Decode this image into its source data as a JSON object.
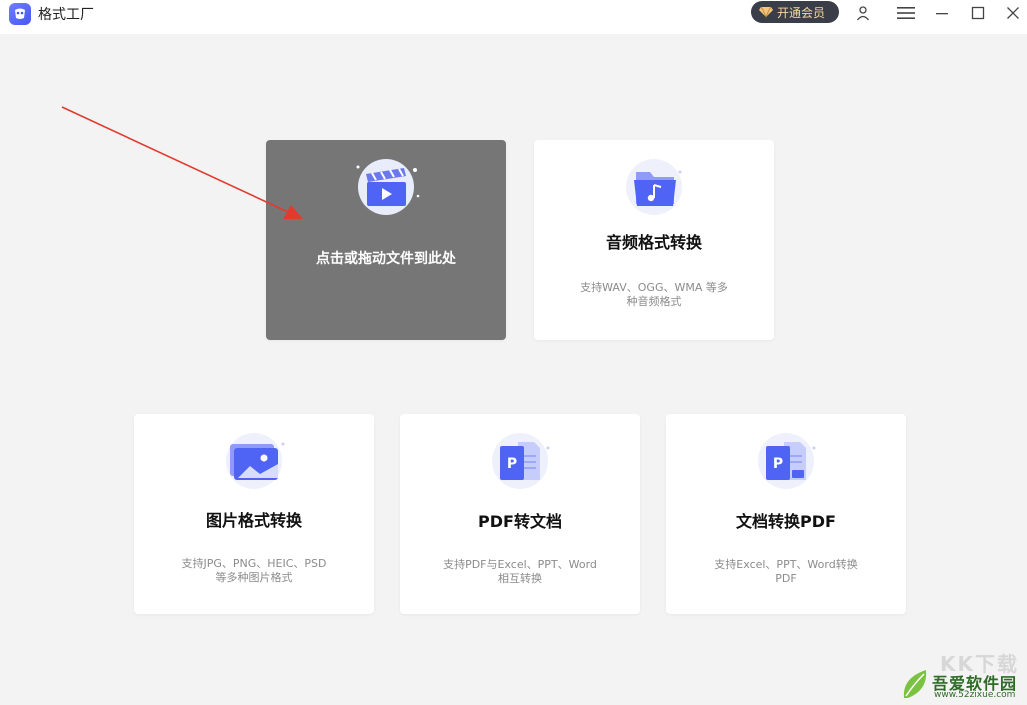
{
  "app": {
    "title": "格式工厂"
  },
  "header": {
    "vip_label": "开通会员"
  },
  "cards": {
    "drop": {
      "title": "点击或拖动文件到此处"
    },
    "audio": {
      "title": "音频格式转换",
      "desc": "支持WAV、OGG、WMA 等多\n种音频格式"
    },
    "image": {
      "title": "图片格式转换",
      "desc": "支持JPG、PNG、HEIC、PSD\n等多种图片格式"
    },
    "pdf_to_doc": {
      "title": "PDF转文档",
      "desc": "支持PDF与Excel、PPT、Word\n相互转换"
    },
    "doc_to_pdf": {
      "title": "文档转换PDF",
      "desc": "支持Excel、PPT、Word转换\nPDF"
    }
  },
  "watermark": {
    "top": "KK下载",
    "name": "吾爱软件园",
    "url": "www.52zixue.com"
  },
  "colors": {
    "accent": "#4f64f4",
    "drop_bg": "#767676",
    "arrow": "#e23b2e",
    "vip_bg": "#3a3e49"
  },
  "icons": {
    "menu": "hamburger-icon",
    "user": "user-icon",
    "minimize": "minimize-icon",
    "maximize": "maximize-icon",
    "close": "close-icon"
  }
}
